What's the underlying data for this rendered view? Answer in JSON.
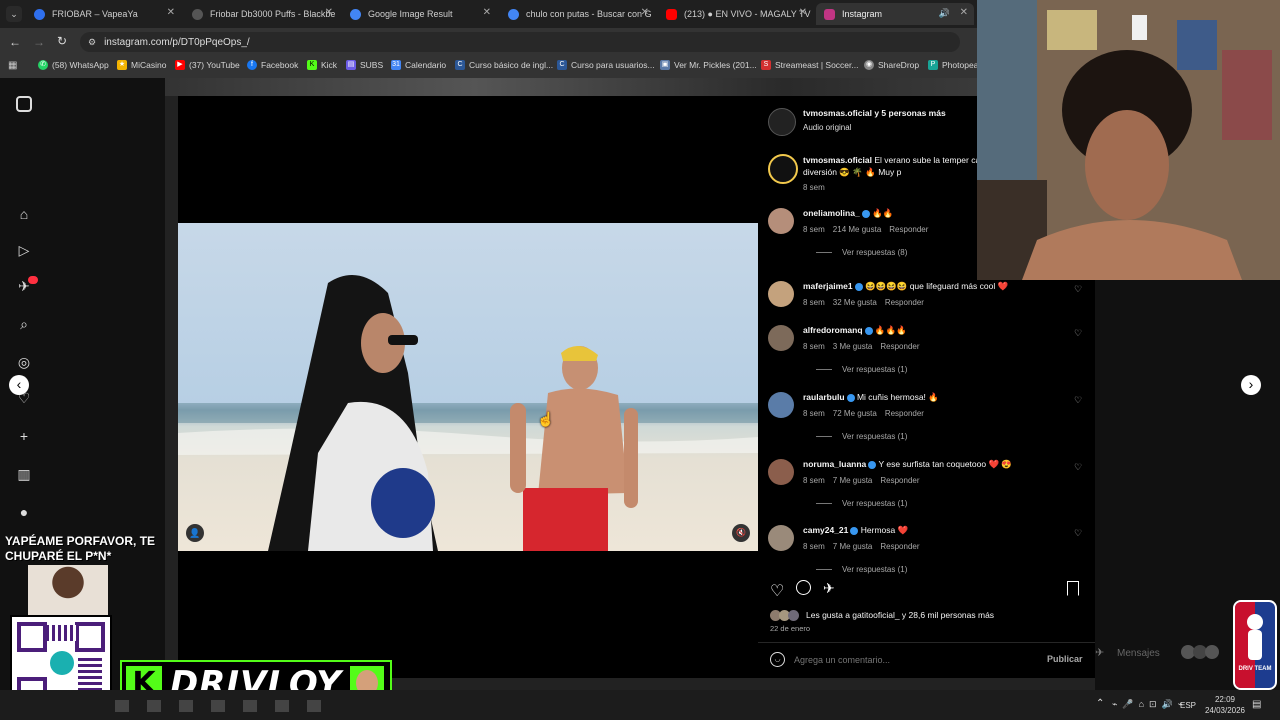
{
  "tabs": [
    {
      "title": "FRIOBAR – VapeaYa",
      "color": "#2f6fed"
    },
    {
      "title": "Friobar Db3000 Puffs - Blackbe",
      "color": "#444"
    },
    {
      "title": "Google Image Result",
      "color": "#4285f4"
    },
    {
      "title": "chulo con putas - Buscar con G",
      "color": "#4285f4"
    },
    {
      "title": "(213) ● EN VIVO - MAGALY TV",
      "color": "#ff0000"
    },
    {
      "title": "Instagram",
      "color": "#c13584"
    }
  ],
  "address": {
    "url": "instagram.com/p/DT0pPqeOps_/"
  },
  "bookmarks": [
    {
      "label": "(58) WhatsApp",
      "color": "#25d366"
    },
    {
      "label": "MiCasino",
      "color": "#f4b400"
    },
    {
      "label": "(37) YouTube",
      "color": "#ff0000"
    },
    {
      "label": "Facebook",
      "color": "#1877f2"
    },
    {
      "label": "Kick",
      "color": "#53fc18"
    },
    {
      "label": "SUBS",
      "color": "#6c5ce7"
    },
    {
      "label": "Calendario",
      "color": "#4285f4"
    },
    {
      "label": "Curso básico de ingl...",
      "color": "#2b5797"
    },
    {
      "label": "Curso para usuarios...",
      "color": "#2b5797"
    },
    {
      "label": "Ver Mr. Pickles (201...",
      "color": "#5a7aa8"
    },
    {
      "label": "Streameast | Soccer...",
      "color": "#d32f2f"
    },
    {
      "label": "ShareDrop",
      "color": "#888"
    },
    {
      "label": "Photopea",
      "color": "#18a497"
    }
  ],
  "post": {
    "header_user": "tvmosmas.oficial y 5 personas más",
    "header_audio": "Audio original",
    "caption_user": "tvmosmas.oficial",
    "caption_text": "El verano sube la temper caras y vuelve la diversión 😎 🌴 🔥 Muy p",
    "caption_time": "8 sem",
    "likes_text": "Les gusta a gatitooficial_ y 28,6 mil personas más",
    "date": "22 de enero",
    "comment_placeholder": "Agrega un comentario...",
    "publish": "Publicar"
  },
  "comments": [
    {
      "user": "oneliamolina_",
      "text": "🔥🔥",
      "time": "8 sem",
      "likes": "214 Me gusta",
      "reply": "Responder",
      "replies": "Ver respuestas (8)",
      "avatar": "#b58e7a"
    },
    {
      "user": "maferjaime1",
      "text": "😆😆😆😆 que lifeguard más cool ❤️",
      "time": "8 sem",
      "likes": "32 Me gusta",
      "reply": "Responder",
      "replies": "",
      "avatar": "#c4a27d"
    },
    {
      "user": "alfredoromanq",
      "text": "🔥🔥🔥",
      "time": "8 sem",
      "likes": "3 Me gusta",
      "reply": "Responder",
      "replies": "Ver respuestas (1)",
      "avatar": "#7d6a5a"
    },
    {
      "user": "raularbulu",
      "text": "Mi cuñis hermosa! 🔥",
      "time": "8 sem",
      "likes": "72 Me gusta",
      "reply": "Responder",
      "replies": "Ver respuestas (1)",
      "avatar": "#5a7ca8"
    },
    {
      "user": "noruma_luanna",
      "text": "Y ese surfista tan coquetooo ❤️ 😍",
      "time": "8 sem",
      "likes": "7 Me gusta",
      "reply": "Responder",
      "replies": "Ver respuestas (1)",
      "avatar": "#8b5e4c"
    },
    {
      "user": "camy24_21",
      "text": "Hermosa ❤️",
      "time": "8 sem",
      "likes": "7 Me gusta",
      "reply": "Responder",
      "replies": "Ver respuestas (1)",
      "avatar": "#9a8a7a"
    }
  ],
  "overlay": {
    "yape_text": "YAPÉAME PORFAVOR, TE CHUPARÉ  EL P*N*",
    "brand": "DRIVLOY",
    "k_letter": "K",
    "messages": "Mensajes",
    "team_badge": "DRIV TEAM"
  },
  "taskbar": {
    "lang": "ESP",
    "time": "22:09",
    "date": "24/03/2026"
  }
}
